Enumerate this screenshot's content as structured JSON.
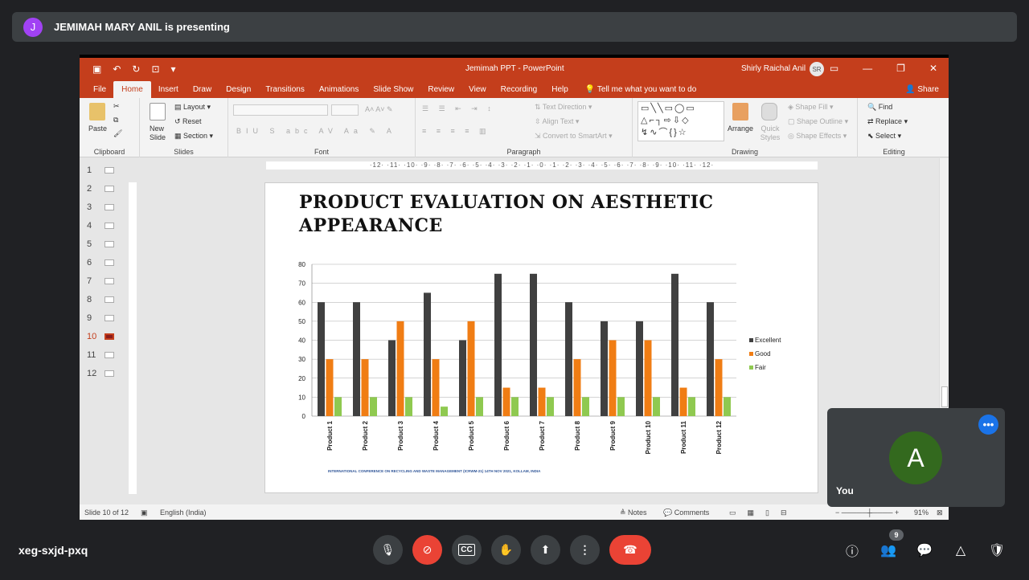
{
  "presenter": {
    "initial": "J",
    "text": "JEMIMAH MARY ANIL is presenting"
  },
  "ppt": {
    "doc_title": "Jemimah PPT  -  PowerPoint",
    "user_name": "Shirly Raichal Anil",
    "user_initials": "SR",
    "tabs": [
      "File",
      "Home",
      "Insert",
      "Draw",
      "Design",
      "Transitions",
      "Animations",
      "Slide Show",
      "Review",
      "View",
      "Recording",
      "Help"
    ],
    "tell_me": "Tell me what you want to do",
    "share": "Share",
    "ribbon": {
      "clipboard": {
        "label": "Clipboard",
        "paste": "Paste"
      },
      "slides": {
        "label": "Slides",
        "new_slide": "New Slide",
        "layout": "Layout",
        "reset": "Reset",
        "section": "Section"
      },
      "font": {
        "label": "Font"
      },
      "paragraph": {
        "label": "Paragraph",
        "text_direction": "Text Direction",
        "align_text": "Align Text",
        "convert_smartart": "Convert to SmartArt"
      },
      "drawing": {
        "label": "Drawing",
        "arrange": "Arrange",
        "quick_styles": "Quick Styles",
        "shape_fill": "Shape Fill",
        "shape_outline": "Shape Outline",
        "shape_effects": "Shape Effects"
      },
      "editing": {
        "label": "Editing",
        "find": "Find",
        "replace": "Replace",
        "select": "Select"
      }
    },
    "ruler_text": "·12·  ·11·  ·10·  ·9·  ·8·  ·7·  ·6·  ·5·  ·4·  ·3·  ·2·  ·1·  ·0·  ·1·  ·2·  ·3·  ·4·  ·5·  ·6·  ·7·  ·8·  ·9·  ·10·  ·11·  ·12·",
    "slide_numbers": [
      "1",
      "2",
      "3",
      "4",
      "5",
      "6",
      "7",
      "8",
      "9",
      "10",
      "11",
      "12"
    ],
    "active_slide": "10",
    "slide": {
      "title": "PRODUCT EVALUATION ON AESTHETIC APPEARANCE",
      "footer": "INTERNATIONAL CONFERENCE ON RECYCLING AND WASTE MANAGEMENT (ICRWM-21) 14TH NOV 2021, KOLLAM, INDIA"
    },
    "status": {
      "slide_of": "Slide 10 of 12",
      "language": "English (India)",
      "notes": "Notes",
      "comments": "Comments",
      "zoom": "91%"
    }
  },
  "chart_data": {
    "type": "bar",
    "categories": [
      "Product 1",
      "Product 2",
      "Product 3",
      "Product 4",
      "Product 5",
      "Product 6",
      "Product 7",
      "Product 8",
      "Product 9",
      "Product 10",
      "Product 11",
      "Product 12"
    ],
    "series": [
      {
        "name": "Excellent",
        "color": "#404040",
        "values": [
          60,
          60,
          40,
          65,
          40,
          75,
          75,
          60,
          50,
          50,
          75,
          60
        ]
      },
      {
        "name": "Good",
        "color": "#f07d14",
        "values": [
          30,
          30,
          50,
          30,
          50,
          15,
          15,
          30,
          40,
          40,
          15,
          30
        ]
      },
      {
        "name": "Fair",
        "color": "#8fc950",
        "values": [
          10,
          10,
          10,
          5,
          10,
          10,
          10,
          10,
          10,
          10,
          10,
          10
        ]
      }
    ],
    "ylim": [
      0,
      80
    ],
    "yticks": [
      0,
      10,
      20,
      30,
      40,
      50,
      60,
      70,
      80
    ],
    "grid": true,
    "legend": "right"
  },
  "self_tile": {
    "initial": "A",
    "name": "You"
  },
  "meeting": {
    "code": "xeg-sxjd-pxq",
    "people_count": "9"
  }
}
